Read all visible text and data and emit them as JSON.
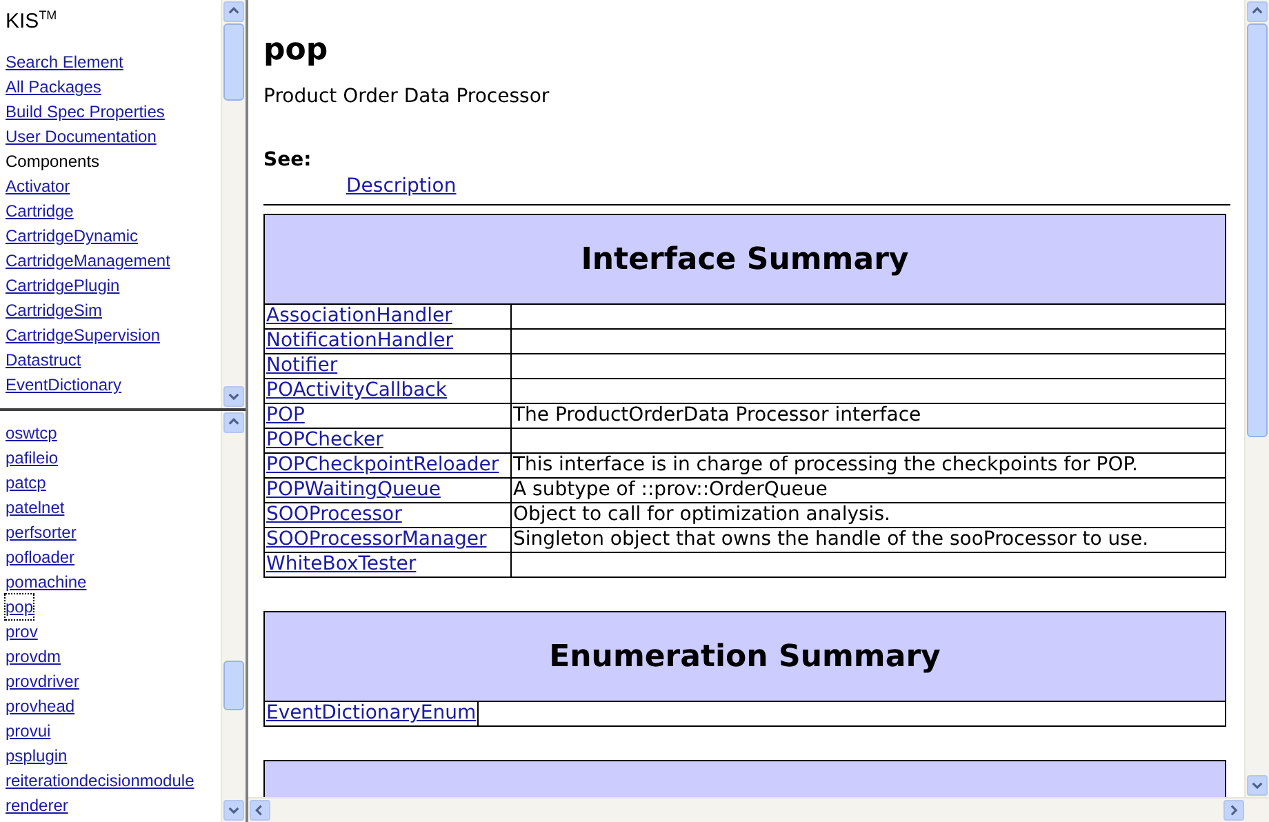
{
  "nav_frame": {
    "title": "KIS$^{TM}$",
    "items": [
      {
        "kind": "link",
        "label": "Search Element"
      },
      {
        "kind": "link",
        "label": "All Packages"
      },
      {
        "kind": "link",
        "label": "Build Spec Properties"
      },
      {
        "kind": "link",
        "label": "User Documentation"
      },
      {
        "kind": "heading",
        "label": "Components"
      },
      {
        "kind": "link",
        "label": "Activator"
      },
      {
        "kind": "link",
        "label": "Cartridge"
      },
      {
        "kind": "link",
        "label": "CartridgeDynamic"
      },
      {
        "kind": "link",
        "label": "CartridgeManagement"
      },
      {
        "kind": "link",
        "label": "CartridgePlugin"
      },
      {
        "kind": "link",
        "label": "CartridgeSim"
      },
      {
        "kind": "link",
        "label": "CartridgeSupervision"
      },
      {
        "kind": "link",
        "label": "Datastruct"
      },
      {
        "kind": "link",
        "label": "EventDictionary"
      }
    ]
  },
  "package_frame": {
    "items": [
      {
        "label": "oswtcp",
        "selected": false
      },
      {
        "label": "pafileio",
        "selected": false
      },
      {
        "label": "patcp",
        "selected": false
      },
      {
        "label": "patelnet",
        "selected": false
      },
      {
        "label": "perfsorter",
        "selected": false
      },
      {
        "label": "pofloader",
        "selected": false
      },
      {
        "label": "pomachine",
        "selected": false
      },
      {
        "label": "pop",
        "selected": true
      },
      {
        "label": "prov",
        "selected": false
      },
      {
        "label": "provdm",
        "selected": false
      },
      {
        "label": "provdriver",
        "selected": false
      },
      {
        "label": "provhead",
        "selected": false
      },
      {
        "label": "provui",
        "selected": false
      },
      {
        "label": "psplugin",
        "selected": false
      },
      {
        "label": "reiterationdecisionmodule",
        "selected": false
      },
      {
        "label": "renderer",
        "selected": false
      }
    ]
  },
  "content": {
    "title": "pop",
    "description": "Product Order Data Processor",
    "see_label": "See:",
    "see_link": "Description",
    "summaries": [
      {
        "kind": "table",
        "title": "Interface Summary",
        "rows": [
          {
            "name": "AssociationHandler"
          },
          {
            "name": "NotificationHandler"
          },
          {
            "name": "Notifier"
          },
          {
            "name": "POActivityCallback"
          },
          {
            "name": "POP",
            "description": "The ProductOrderData Processor interface"
          },
          {
            "name": "POPChecker"
          },
          {
            "name": "POPCheckpointReloader",
            "description": "This interface is in charge of processing the checkpoints for POP."
          },
          {
            "name": "POPWaitingQueue",
            "description": "A subtype of ::prov::OrderQueue"
          },
          {
            "name": "SOOProcessor",
            "description": "Object to call for optimization analysis."
          },
          {
            "name": "SOOProcessorManager",
            "description": "Singleton object that owns the handle of the sooProcessor to use."
          },
          {
            "name": "WhiteBoxTester"
          }
        ]
      },
      {
        "kind": "table",
        "title": "Enumeration Summary",
        "rows": [
          {
            "name": "EventDictionaryEnum"
          }
        ]
      },
      {
        "kind": "cut_off"
      }
    ]
  }
}
